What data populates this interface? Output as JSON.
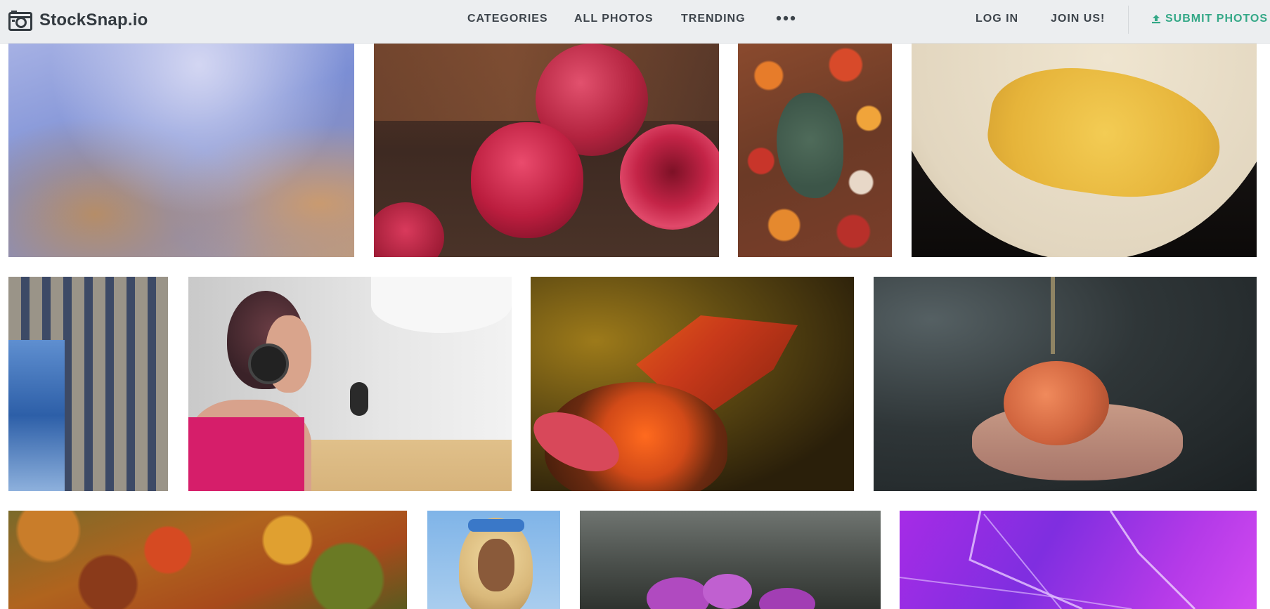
{
  "brand": {
    "name": "StockSnap.io",
    "logo_icon": "camera-icon"
  },
  "nav": {
    "categories": "CATEGORIES",
    "all_photos": "ALL PHOTOS",
    "trending": "TRENDING",
    "more_icon": "more-dots-icon",
    "login": "LOG IN",
    "join": "JOIN US!",
    "submit": "SUBMIT PHOTOS",
    "submit_icon": "upload-icon"
  },
  "colors": {
    "navbar_bg": "#eceef0",
    "nav_text": "#3d444b",
    "accent_green": "#34a887"
  },
  "photos": [
    {
      "subject": "blurred blue and orange abstract"
    },
    {
      "subject": "raspberries on wooden table"
    },
    {
      "subject": "autumn leaves on mossy rock"
    },
    {
      "subject": "globe showing Australia"
    },
    {
      "subject": "glass office building facade"
    },
    {
      "subject": "woman with headphones recording podcast"
    },
    {
      "subject": "monarch butterfly on coneflower"
    },
    {
      "subject": "hands holding small pumpkin"
    },
    {
      "subject": "aerial autumn forest"
    },
    {
      "subject": "woman with blonde curly hair and sunglasses"
    },
    {
      "subject": "pink orchid on dark background"
    },
    {
      "subject": "purple abstract light lines"
    }
  ]
}
